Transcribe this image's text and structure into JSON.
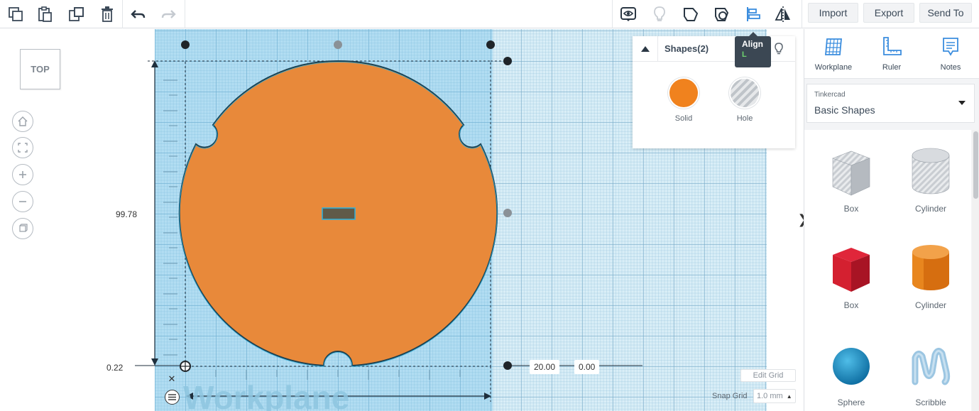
{
  "toolbar": {
    "left_icons": [
      "copy-icon",
      "paste-icon",
      "duplicate-icon",
      "delete-icon",
      "undo-icon",
      "redo-icon"
    ],
    "right_icons": [
      "show-all-icon",
      "light-bulb-icon",
      "group-icon",
      "ungroup-icon",
      "align-icon",
      "mirror-icon"
    ],
    "import_label": "Import",
    "export_label": "Export",
    "send_to_label": "Send To"
  },
  "view": {
    "viewcube_label": "TOP",
    "controls": [
      "home-icon",
      "fit-view-icon",
      "zoom-in-icon",
      "zoom-out-icon",
      "perspective-icon"
    ]
  },
  "dimensions": {
    "height_value": "99.78",
    "elevation_value": "0.22",
    "x_offset_value": "20.00",
    "y_offset_value": "0.00"
  },
  "canvas": {
    "workplane_label": "Workplane",
    "edit_grid_label": "Edit Grid",
    "snap_grid_label": "Snap Grid",
    "snap_grid_value": "1.0 mm"
  },
  "inspector": {
    "title": "Shapes(2)",
    "solid_label": "Solid",
    "hole_label": "Hole",
    "solid_color": "#f0821e"
  },
  "tooltip": {
    "title": "Align",
    "shortcut": "L"
  },
  "right_panel": {
    "tools": [
      {
        "label": "Workplane",
        "icon": "workplane-icon"
      },
      {
        "label": "Ruler",
        "icon": "ruler-icon"
      },
      {
        "label": "Notes",
        "icon": "notes-icon"
      }
    ],
    "library_category": "Tinkercad",
    "library_name": "Basic Shapes",
    "shapes": [
      {
        "label": "Box",
        "kind": "box-hole"
      },
      {
        "label": "Cylinder",
        "kind": "cylinder-hole"
      },
      {
        "label": "Box",
        "kind": "box-red"
      },
      {
        "label": "Cylinder",
        "kind": "cylinder-orange"
      },
      {
        "label": "Sphere",
        "kind": "sphere-blue"
      },
      {
        "label": "Scribble",
        "kind": "scribble"
      }
    ]
  },
  "colors": {
    "accent": "#3b8dde",
    "shape_orange": "#e8893a",
    "box_red": "#d42030",
    "sphere_blue": "#1e8fc8"
  }
}
